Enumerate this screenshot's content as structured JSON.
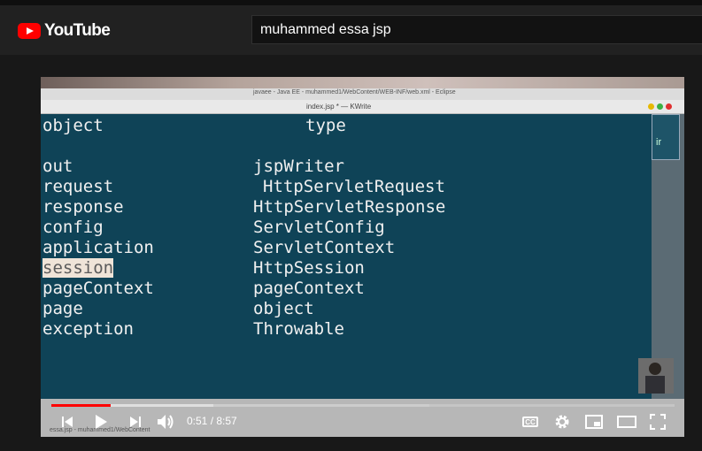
{
  "header": {
    "logo_text": "YouTube",
    "search_value": "muhammed essa jsp"
  },
  "eclipse": {
    "window_title": "javaee - Java EE - muhammed1/WebContent/WEB-INF/web.xml - Eclipse",
    "kwrite_title": "index.jsp * — KWrite",
    "minimap_text": "ir",
    "bottom_label": "essa.jsp - muhammed1/WebContent"
  },
  "editor": {
    "header_left": "object",
    "header_right": "type",
    "rows": [
      {
        "object": "out",
        "type": "jspWriter"
      },
      {
        "object": "request",
        "type": "HttpServletRequest"
      },
      {
        "object": "response",
        "type": "HttpServletResponse"
      },
      {
        "object": "config",
        "type": "ServletConfig"
      },
      {
        "object": "application",
        "type": "ServletContext"
      },
      {
        "object": "session",
        "type": "HttpSession"
      },
      {
        "object": "pageContext",
        "type": "pageContext"
      },
      {
        "object": "page",
        "type": "object"
      },
      {
        "object": "exception",
        "type": "Throwable"
      }
    ],
    "highlighted": "session"
  },
  "player": {
    "time_display": "0:51 / 8:57",
    "cc_label": "CC",
    "progress_played_fraction": 0.095,
    "progress_buffered_fraction": 0.26
  },
  "colors": {
    "brand_red": "#ff0000",
    "editor_bg": "#0f4357"
  }
}
